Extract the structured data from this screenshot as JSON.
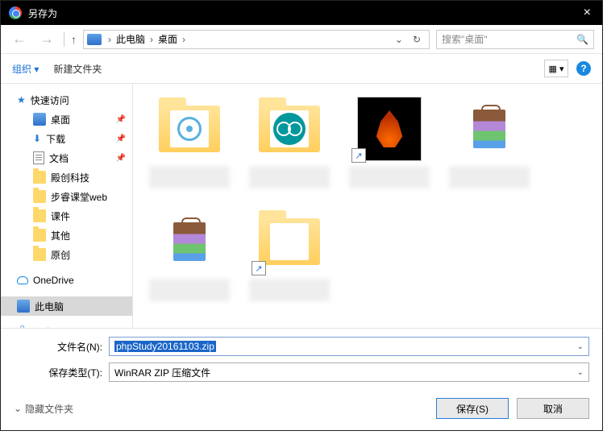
{
  "titlebar": {
    "title": "另存为",
    "close": "×"
  },
  "nav": {
    "back": "←",
    "forward": "→",
    "up": "↑",
    "crumbs": [
      "此电脑",
      "桌面"
    ],
    "search_placeholder": "搜索\"桌面\""
  },
  "toolbar": {
    "organize": "组织 ▾",
    "new_folder": "新建文件夹",
    "view_glyph": "▦ ▾"
  },
  "sidebar": {
    "quick": "快速访问",
    "desktop": "桌面",
    "downloads": "下载",
    "documents": "文档",
    "f1": "殿创科技",
    "f2": "步睿课堂web",
    "f3": "课件",
    "f4": "其他",
    "f5": "原创",
    "onedrive": "OneDrive",
    "thispc": "此电脑",
    "network": "网络"
  },
  "filename": {
    "label": "文件名(N):",
    "value": "phpStudy20161103.zip"
  },
  "filetype": {
    "label": "保存类型(T):",
    "value": "WinRAR ZIP 压缩文件"
  },
  "footer": {
    "hide": "隐藏文件夹",
    "save": "保存(S)",
    "cancel": "取消"
  }
}
